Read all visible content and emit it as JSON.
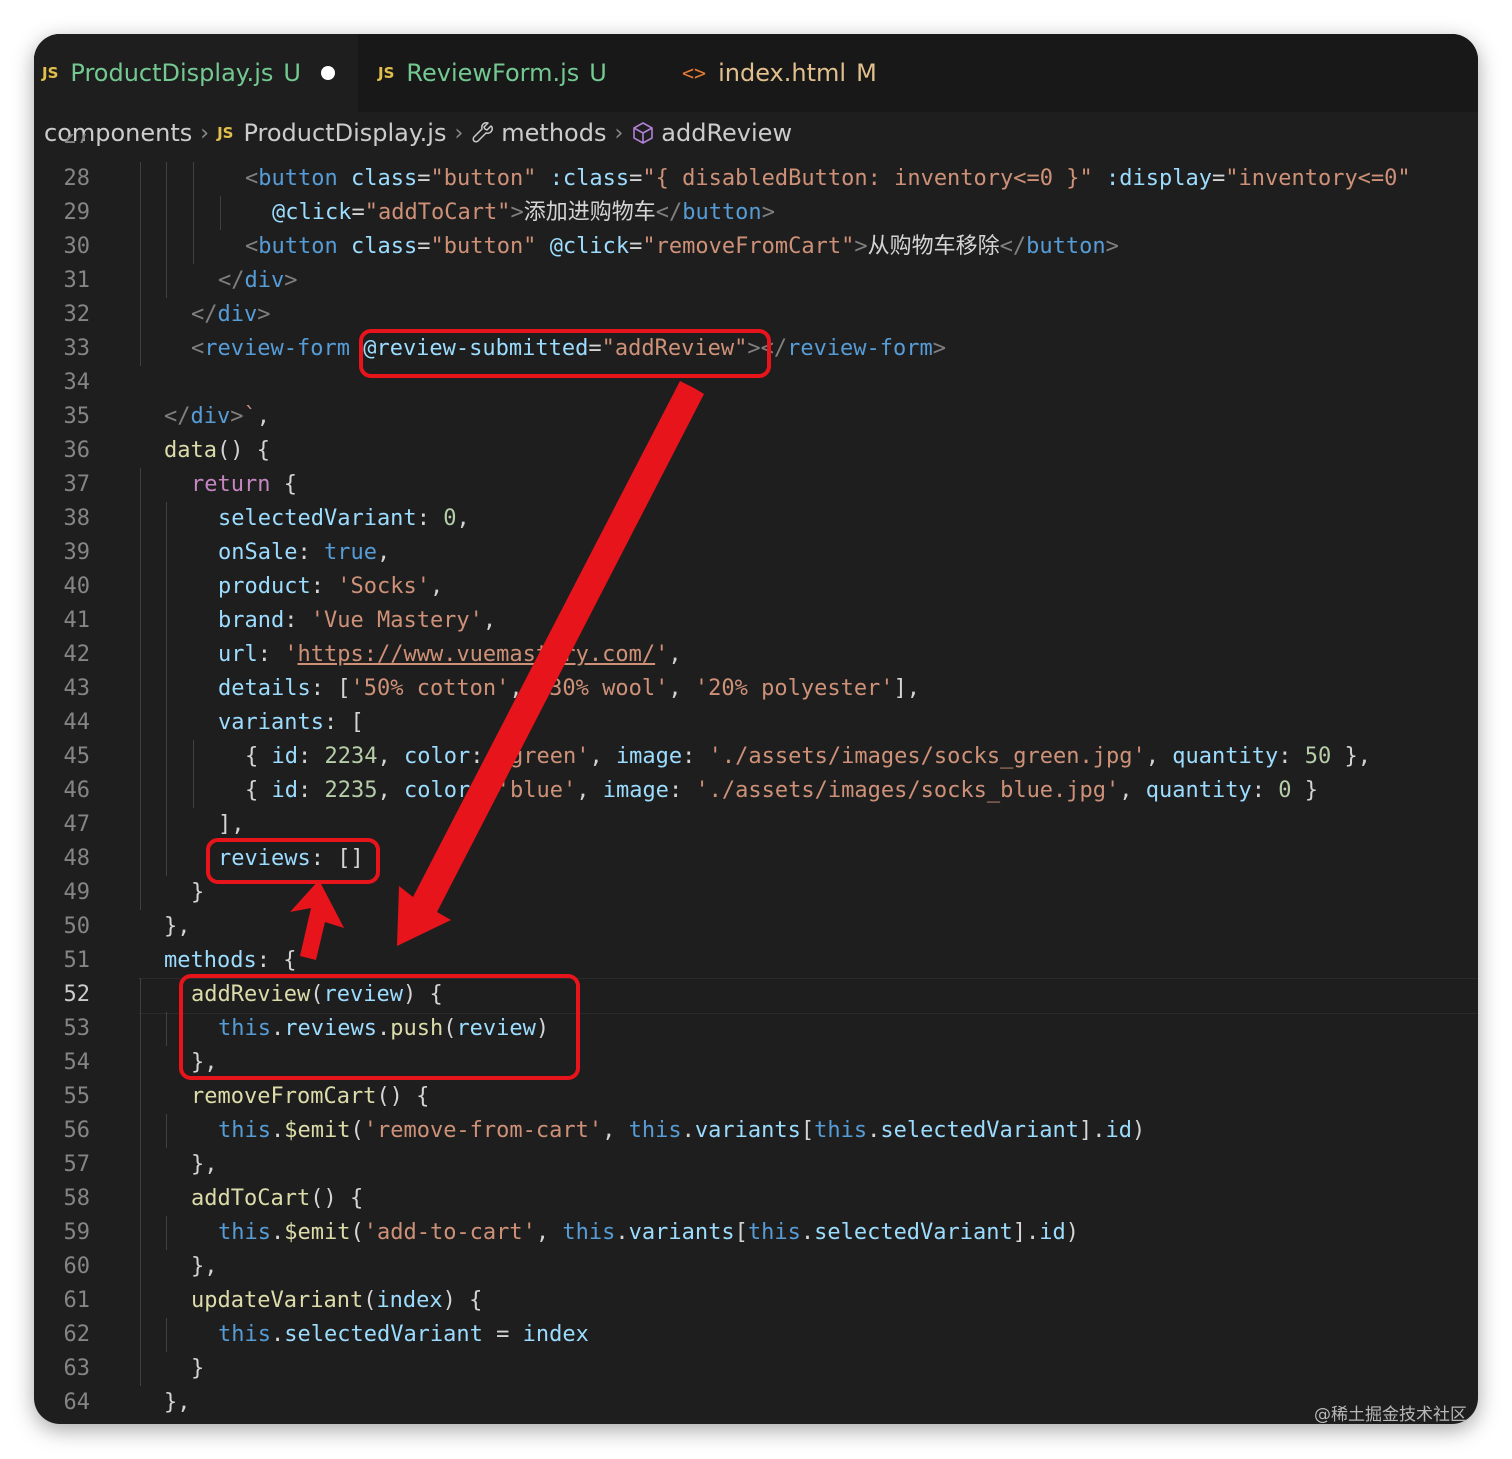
{
  "tabs": [
    {
      "name": "ProductDisplay.js",
      "badge": "U",
      "icon": "JS",
      "icon_name": "js-file-icon",
      "modified_dot": true
    },
    {
      "name": "ReviewForm.js",
      "badge": "U",
      "icon": "JS",
      "icon_name": "js-file-icon"
    },
    {
      "name": "index.html",
      "badge": "M",
      "icon": "<>",
      "icon_name": "html-file-icon"
    }
  ],
  "breadcrumb": {
    "folder": "components",
    "file_icon": "JS",
    "file": "ProductDisplay.js",
    "section_icon": "wrench-icon",
    "section": "methods",
    "symbol_icon": "cube-icon",
    "symbol": "addReview"
  },
  "editor": {
    "active_line": 52,
    "partial_top_line": "27",
    "lines": [
      {
        "n": "28",
        "indent": 3,
        "tokens": [
          [
            "br",
            "<"
          ],
          [
            "tag",
            "button"
          ],
          [
            "txt",
            " "
          ],
          [
            "at",
            "class"
          ],
          [
            "txt",
            "="
          ],
          [
            "str",
            "\"button\""
          ],
          [
            "txt",
            " "
          ],
          [
            "at",
            ":class"
          ],
          [
            "txt",
            "="
          ],
          [
            "str",
            "\"{ disabledButton: inventory<=0 }\""
          ],
          [
            "txt",
            " "
          ],
          [
            "at",
            ":display"
          ],
          [
            "txt",
            "="
          ],
          [
            "str",
            "\"inventory<=0\""
          ]
        ]
      },
      {
        "n": "29",
        "indent": 4,
        "tokens": [
          [
            "at",
            "@click"
          ],
          [
            "txt",
            "="
          ],
          [
            "str",
            "\"addToCart\""
          ],
          [
            "br",
            ">"
          ],
          [
            "txt",
            "添加进购物车"
          ],
          [
            "br",
            "</"
          ],
          [
            "tag",
            "button"
          ],
          [
            "br",
            ">"
          ]
        ]
      },
      {
        "n": "30",
        "indent": 3,
        "tokens": [
          [
            "br",
            "<"
          ],
          [
            "tag",
            "button"
          ],
          [
            "txt",
            " "
          ],
          [
            "at",
            "class"
          ],
          [
            "txt",
            "="
          ],
          [
            "str",
            "\"button\""
          ],
          [
            "txt",
            " "
          ],
          [
            "at",
            "@click"
          ],
          [
            "txt",
            "="
          ],
          [
            "str",
            "\"removeFromCart\""
          ],
          [
            "br",
            ">"
          ],
          [
            "txt",
            "从购物车移除"
          ],
          [
            "br",
            "</"
          ],
          [
            "tag",
            "button"
          ],
          [
            "br",
            ">"
          ]
        ]
      },
      {
        "n": "31",
        "indent": 2,
        "tokens": [
          [
            "br",
            "</"
          ],
          [
            "tag",
            "div"
          ],
          [
            "br",
            ">"
          ]
        ]
      },
      {
        "n": "32",
        "indent": 1,
        "tokens": [
          [
            "br",
            "</"
          ],
          [
            "tag",
            "div"
          ],
          [
            "br",
            ">"
          ]
        ]
      },
      {
        "n": "33",
        "indent": 1,
        "tokens": [
          [
            "br",
            "<"
          ],
          [
            "tag",
            "review-form"
          ],
          [
            "txt",
            " "
          ],
          [
            "at",
            "@review-submitted"
          ],
          [
            "txt",
            "="
          ],
          [
            "str",
            "\"addReview\""
          ],
          [
            "br",
            ">"
          ],
          [
            "br",
            "</"
          ],
          [
            "tag",
            "review-form"
          ],
          [
            "br",
            ">"
          ]
        ]
      },
      {
        "n": "34",
        "indent": 0,
        "tokens": []
      },
      {
        "n": "35",
        "indent": 0,
        "tokens": [
          [
            "br",
            "</"
          ],
          [
            "tag",
            "div"
          ],
          [
            "br",
            ">"
          ],
          [
            "str",
            "`"
          ],
          [
            "txt",
            ","
          ]
        ]
      },
      {
        "n": "36",
        "indent": 0,
        "tokens": [
          [
            "fn",
            "data"
          ],
          [
            "txt",
            "() {"
          ]
        ]
      },
      {
        "n": "37",
        "indent": 1,
        "tokens": [
          [
            "ctl",
            "return"
          ],
          [
            "txt",
            " {"
          ]
        ]
      },
      {
        "n": "38",
        "indent": 2,
        "tokens": [
          [
            "var",
            "selectedVariant"
          ],
          [
            "txt",
            ": "
          ],
          [
            "num",
            "0"
          ],
          [
            "txt",
            ","
          ]
        ]
      },
      {
        "n": "39",
        "indent": 2,
        "tokens": [
          [
            "var",
            "onSale"
          ],
          [
            "txt",
            ": "
          ],
          [
            "kw",
            "true"
          ],
          [
            "txt",
            ","
          ]
        ]
      },
      {
        "n": "40",
        "indent": 2,
        "tokens": [
          [
            "var",
            "product"
          ],
          [
            "txt",
            ": "
          ],
          [
            "str",
            "'Socks'"
          ],
          [
            "txt",
            ","
          ]
        ]
      },
      {
        "n": "41",
        "indent": 2,
        "tokens": [
          [
            "var",
            "brand"
          ],
          [
            "txt",
            ": "
          ],
          [
            "str",
            "'Vue Mastery'"
          ],
          [
            "txt",
            ","
          ]
        ]
      },
      {
        "n": "42",
        "indent": 2,
        "tokens": [
          [
            "var",
            "url"
          ],
          [
            "txt",
            ": "
          ],
          [
            "str",
            "'"
          ],
          [
            "url",
            "https://www.vuemastery.com/"
          ],
          [
            "str",
            "'"
          ],
          [
            "txt",
            ","
          ]
        ]
      },
      {
        "n": "43",
        "indent": 2,
        "tokens": [
          [
            "var",
            "details"
          ],
          [
            "txt",
            ": ["
          ],
          [
            "str",
            "'50% cotton'"
          ],
          [
            "txt",
            ", "
          ],
          [
            "str",
            "'30% wool'"
          ],
          [
            "txt",
            ", "
          ],
          [
            "str",
            "'20% polyester'"
          ],
          [
            "txt",
            "],"
          ]
        ]
      },
      {
        "n": "44",
        "indent": 2,
        "tokens": [
          [
            "var",
            "variants"
          ],
          [
            "txt",
            ": ["
          ]
        ]
      },
      {
        "n": "45",
        "indent": 3,
        "tokens": [
          [
            "txt",
            "{ "
          ],
          [
            "var",
            "id"
          ],
          [
            "txt",
            ": "
          ],
          [
            "num",
            "2234"
          ],
          [
            "txt",
            ", "
          ],
          [
            "var",
            "color"
          ],
          [
            "txt",
            ": "
          ],
          [
            "str",
            "'green'"
          ],
          [
            "txt",
            ", "
          ],
          [
            "var",
            "image"
          ],
          [
            "txt",
            ": "
          ],
          [
            "str",
            "'./assets/images/socks_green.jpg'"
          ],
          [
            "txt",
            ", "
          ],
          [
            "var",
            "quantity"
          ],
          [
            "txt",
            ": "
          ],
          [
            "num",
            "50"
          ],
          [
            "txt",
            " },"
          ]
        ]
      },
      {
        "n": "46",
        "indent": 3,
        "tokens": [
          [
            "txt",
            "{ "
          ],
          [
            "var",
            "id"
          ],
          [
            "txt",
            ": "
          ],
          [
            "num",
            "2235"
          ],
          [
            "txt",
            ", "
          ],
          [
            "var",
            "color"
          ],
          [
            "txt",
            ": "
          ],
          [
            "str",
            "'blue'"
          ],
          [
            "txt",
            ", "
          ],
          [
            "var",
            "image"
          ],
          [
            "txt",
            ": "
          ],
          [
            "str",
            "'./assets/images/socks_blue.jpg'"
          ],
          [
            "txt",
            ", "
          ],
          [
            "var",
            "quantity"
          ],
          [
            "txt",
            ": "
          ],
          [
            "num",
            "0"
          ],
          [
            "txt",
            " }"
          ]
        ]
      },
      {
        "n": "47",
        "indent": 2,
        "tokens": [
          [
            "txt",
            "],"
          ]
        ]
      },
      {
        "n": "48",
        "indent": 2,
        "tokens": [
          [
            "var",
            "reviews"
          ],
          [
            "txt",
            ": []"
          ]
        ]
      },
      {
        "n": "49",
        "indent": 1,
        "tokens": [
          [
            "txt",
            "}"
          ]
        ]
      },
      {
        "n": "50",
        "indent": 0,
        "tokens": [
          [
            "txt",
            "},"
          ]
        ]
      },
      {
        "n": "51",
        "indent": 0,
        "tokens": [
          [
            "var",
            "methods"
          ],
          [
            "txt",
            ": {"
          ]
        ]
      },
      {
        "n": "52",
        "indent": 1,
        "tokens": [
          [
            "fn",
            "addReview"
          ],
          [
            "txt",
            "("
          ],
          [
            "var",
            "review"
          ],
          [
            "txt",
            ") {"
          ]
        ]
      },
      {
        "n": "53",
        "indent": 2,
        "tokens": [
          [
            "kw",
            "this"
          ],
          [
            "txt",
            "."
          ],
          [
            "var",
            "reviews"
          ],
          [
            "txt",
            "."
          ],
          [
            "fn",
            "push"
          ],
          [
            "txt",
            "("
          ],
          [
            "var",
            "review"
          ],
          [
            "txt",
            ")"
          ]
        ]
      },
      {
        "n": "54",
        "indent": 1,
        "tokens": [
          [
            "txt",
            "},"
          ]
        ]
      },
      {
        "n": "55",
        "indent": 1,
        "tokens": [
          [
            "fn",
            "removeFromCart"
          ],
          [
            "txt",
            "() {"
          ]
        ]
      },
      {
        "n": "56",
        "indent": 2,
        "tokens": [
          [
            "kw",
            "this"
          ],
          [
            "txt",
            "."
          ],
          [
            "fn",
            "$emit"
          ],
          [
            "txt",
            "("
          ],
          [
            "str",
            "'remove-from-cart'"
          ],
          [
            "txt",
            ", "
          ],
          [
            "kw",
            "this"
          ],
          [
            "txt",
            "."
          ],
          [
            "var",
            "variants"
          ],
          [
            "txt",
            "["
          ],
          [
            "kw",
            "this"
          ],
          [
            "txt",
            "."
          ],
          [
            "var",
            "selectedVariant"
          ],
          [
            "txt",
            "]."
          ],
          [
            "var",
            "id"
          ],
          [
            "txt",
            ")"
          ]
        ]
      },
      {
        "n": "57",
        "indent": 1,
        "tokens": [
          [
            "txt",
            "},"
          ]
        ]
      },
      {
        "n": "58",
        "indent": 1,
        "tokens": [
          [
            "fn",
            "addToCart"
          ],
          [
            "txt",
            "() {"
          ]
        ]
      },
      {
        "n": "59",
        "indent": 2,
        "tokens": [
          [
            "kw",
            "this"
          ],
          [
            "txt",
            "."
          ],
          [
            "fn",
            "$emit"
          ],
          [
            "txt",
            "("
          ],
          [
            "str",
            "'add-to-cart'"
          ],
          [
            "txt",
            ", "
          ],
          [
            "kw",
            "this"
          ],
          [
            "txt",
            "."
          ],
          [
            "var",
            "variants"
          ],
          [
            "txt",
            "["
          ],
          [
            "kw",
            "this"
          ],
          [
            "txt",
            "."
          ],
          [
            "var",
            "selectedVariant"
          ],
          [
            "txt",
            "]."
          ],
          [
            "var",
            "id"
          ],
          [
            "txt",
            ")"
          ]
        ]
      },
      {
        "n": "60",
        "indent": 1,
        "tokens": [
          [
            "txt",
            "},"
          ]
        ]
      },
      {
        "n": "61",
        "indent": 1,
        "tokens": [
          [
            "fn",
            "updateVariant"
          ],
          [
            "txt",
            "("
          ],
          [
            "var",
            "index"
          ],
          [
            "txt",
            ") {"
          ]
        ]
      },
      {
        "n": "62",
        "indent": 2,
        "tokens": [
          [
            "kw",
            "this"
          ],
          [
            "txt",
            "."
          ],
          [
            "var",
            "selectedVariant"
          ],
          [
            "txt",
            " = "
          ],
          [
            "var",
            "index"
          ]
        ]
      },
      {
        "n": "63",
        "indent": 1,
        "tokens": [
          [
            "txt",
            "}"
          ]
        ]
      },
      {
        "n": "64",
        "indent": 0,
        "tokens": [
          [
            "txt",
            "},"
          ]
        ]
      }
    ]
  },
  "annotations": {
    "color": "#e8141b",
    "highlights": [
      {
        "name": "highlight-review-submitted",
        "marks": "@review-submitted=\"addReview\""
      },
      {
        "name": "highlight-reviews-array",
        "marks": "reviews: []"
      },
      {
        "name": "highlight-addreview-method",
        "marks": "addReview(review) { this.reviews.push(review) },"
      }
    ]
  },
  "watermark": "@稀土掘金技术社区"
}
